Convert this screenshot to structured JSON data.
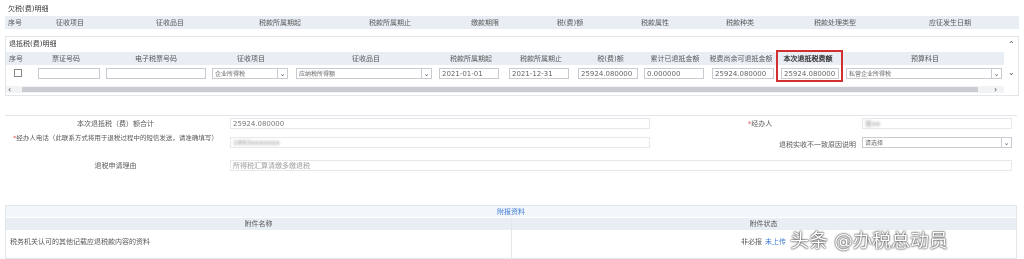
{
  "section_top_title": "欠税(费)明细",
  "top_columns": [
    "序号",
    "征收项目",
    "征收品目",
    "税款所属期起",
    "税款所属期止",
    "缴款期限",
    "税(费)额",
    "税款属性",
    "税款种类",
    "税款处理类型",
    "应征发生日期"
  ],
  "refund_section_title": "退抵税(费)明细",
  "refund_columns": [
    "序号",
    "票证号码",
    "电子税票号码",
    "征收项目",
    "征收品目",
    "税款所属期起",
    "税款所属期止",
    "税(费)额",
    "累计已退抵金额",
    "税费尚余可退抵金额",
    "本次退抵税费额",
    "预算科目"
  ],
  "refund_row": {
    "levy_item": "企业所得税",
    "levy_sub_item": "应纳税所得额",
    "period_start": "2021-01-01",
    "period_end": "2021-12-31",
    "tax_amount": "25924.080000",
    "refunded": "0.000000",
    "remaining": "25924.080000",
    "this_refund": "25924.080000",
    "budget_subject": "私营企业所得税"
  },
  "summary": {
    "total_label": "本次退抵税（费）额合计",
    "total_value": "25924.080000",
    "agent_label": "经办人",
    "phone_label": "经办人电话（此联系方式将用于退税过程中的短信发送，请准确填写）",
    "phone_value": "1893xxxxxxx",
    "mismatch_label": "退税实收不一致原因说明",
    "mismatch_placeholder": "请选择",
    "reason_label": "退税申请理由",
    "reason_value": "所得税汇算清缴多缴退税",
    "agent_value": "张xx"
  },
  "attachments": {
    "title": "附报资料",
    "col_name": "附件名称",
    "col_status": "附件状态",
    "row_name": "税务机关认可的其他记载应退税款内容的资料",
    "row_required": "非必报",
    "row_action": "未上传"
  },
  "watermark": "头条 @办税总动员",
  "colors": {
    "header_bg": "#e9eef5",
    "highlight_border": "#d0302f",
    "link_blue": "#3a7bd5",
    "required_red": "#e05050"
  }
}
